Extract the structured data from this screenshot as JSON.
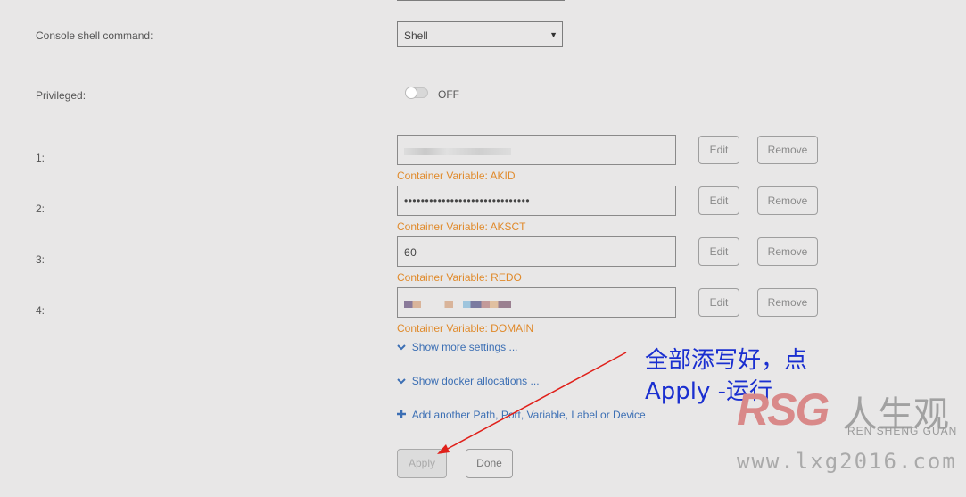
{
  "console": {
    "label": "Console shell command:",
    "value": "Shell"
  },
  "privileged": {
    "label": "Privileged:",
    "state": "OFF"
  },
  "variables": [
    {
      "index": "1:",
      "value": "",
      "caption": "Container Variable: AKID"
    },
    {
      "index": "2:",
      "value": "••••••••••••••••••••••••••••••",
      "caption": "Container Variable: AKSCT"
    },
    {
      "index": "3:",
      "value": "60",
      "caption": "Container Variable: REDO"
    },
    {
      "index": "4:",
      "value": "",
      "caption": "Container Variable: DOMAIN"
    }
  ],
  "buttons": {
    "edit": "Edit",
    "remove": "Remove",
    "apply": "Apply",
    "done": "Done"
  },
  "links": {
    "more_settings": "Show more settings ...",
    "docker_alloc": "Show docker allocations ...",
    "add_another": "Add another Path, Port, Variable, Label or Device"
  },
  "annotation": {
    "line1": "全部添写好，点",
    "line2": "Apply -运行"
  },
  "watermark": {
    "brand": "RSG",
    "cn": "人生观",
    "en": "REN SHENG GUAN",
    "url": "www.lxg2016.com"
  },
  "colors": {
    "accent_orange": "#e08a2b",
    "link_blue": "#3c6fb4",
    "annotation_blue": "#1a2fd0",
    "arrow_red": "#e0201a"
  }
}
